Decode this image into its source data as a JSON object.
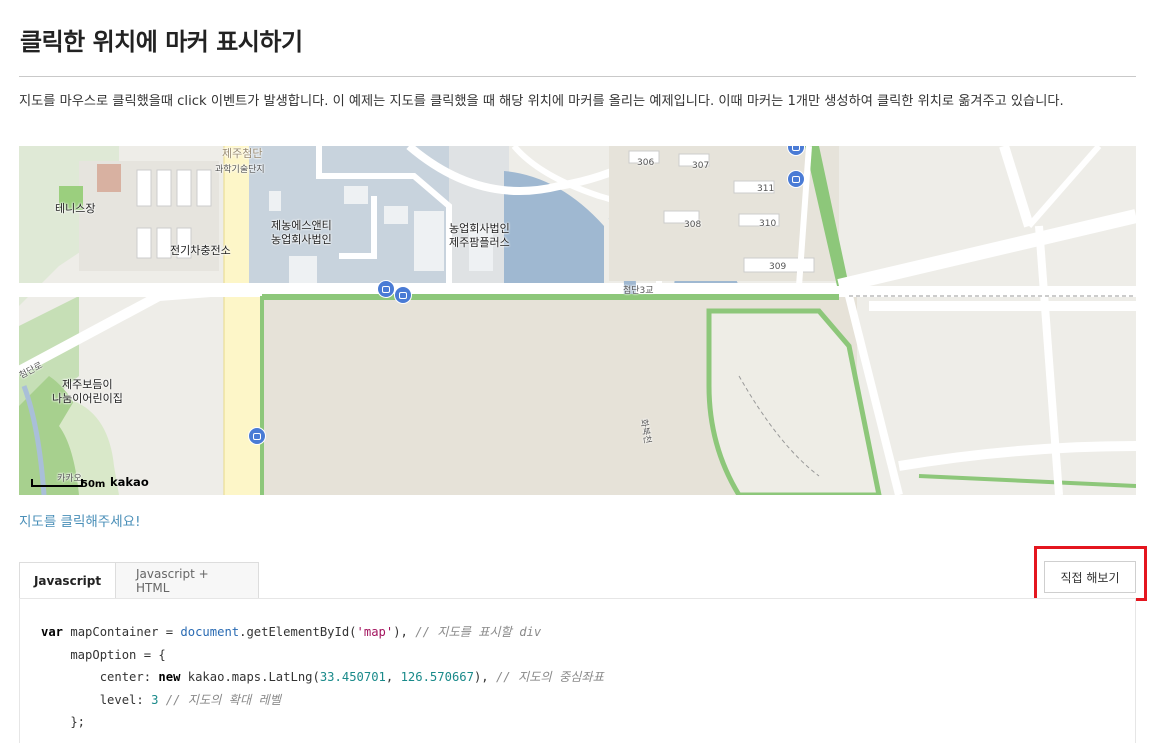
{
  "page": {
    "title": "클릭한 위치에 마커 표시하기",
    "description": "지도를 마우스로 클릭했을때 click 이벤트가 발생합니다. 이 예제는 지도를 클릭했을 때 해당 위치에 마커를 올리는 예제입니다. 이때 마커는 1개만 생성하여 클릭한 위치로 옮겨주고 있습니다.",
    "status_message": "지도를 클릭해주세요!"
  },
  "map": {
    "labels": {
      "cheomdan": "제주첨단",
      "science_park": "과학기술단지",
      "tennis": "테니스장",
      "ev_charging": "전기차충전소",
      "jenong_1": "제농에스앤티",
      "jenong_2": "농업회사법인",
      "nong_1": "농업회사법인",
      "nong_2": "제주팜플러스",
      "bridge": "첨단3교",
      "stream": "화북천",
      "daycare_1": "제주보듬이",
      "daycare_2": "나눔이어린이집",
      "left_road": "첨단로",
      "trail": "카카오",
      "b306": "306",
      "b307": "307",
      "b308": "308",
      "b309": "309",
      "b310": "310",
      "b311": "311"
    },
    "scale_text": "50m",
    "logo": "kakao"
  },
  "tabs": [
    {
      "label": "Javascript",
      "active": true
    },
    {
      "label": "Javascript + HTML",
      "active": false
    }
  ],
  "try_button_label": "직접 해보기",
  "code": {
    "line1": {
      "kw": "var",
      "a": " mapContainer = ",
      "obj": "document",
      "b": ".getElementById(",
      "str": "'map'",
      "c": "), ",
      "cmt": "// 지도를 표시할 div"
    },
    "line2": {
      "text": "    mapOption = {"
    },
    "line3": {
      "a": "        center: ",
      "kw": "new",
      "b": " kakao.maps.LatLng(",
      "n1": "33.450701",
      "c": ", ",
      "n2": "126.570667",
      "d": "), ",
      "cmt": "// 지도의 중심좌표"
    },
    "line4": {
      "a": "        level: ",
      "num": "3",
      "b": " ",
      "cmt": "// 지도의 확대 레벨"
    },
    "line5": {
      "text": "    };"
    }
  },
  "colors": {
    "highlight": "#e4161f",
    "status_text": "#4a8fb8",
    "map_water": "#9fb8d1",
    "map_green": "#8dc77a"
  }
}
